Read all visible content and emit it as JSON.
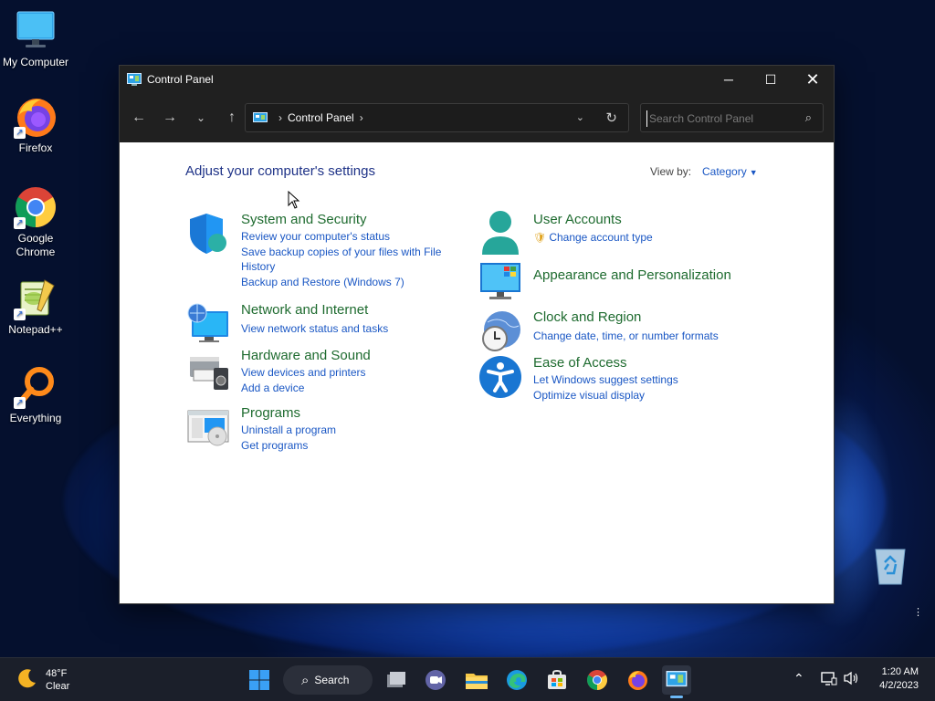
{
  "desktop": {
    "icons": [
      {
        "label": "My Computer",
        "icon": "monitor-icon"
      },
      {
        "label": "Firefox",
        "icon": "firefox-icon"
      },
      {
        "label": "Google Chrome",
        "icon": "chrome-icon"
      },
      {
        "label": "Notepad++",
        "icon": "notepadpp-icon"
      },
      {
        "label": "Everything",
        "icon": "everything-icon"
      }
    ],
    "recycle_bin_icon": "recycle-bin-icon"
  },
  "window": {
    "title": "Control Panel",
    "address": {
      "crumb": "Control Panel"
    },
    "search_placeholder": "Search Control Panel"
  },
  "content": {
    "heading": "Adjust your computer's settings",
    "view_by_label": "View by:",
    "view_by_value": "Category",
    "categories_left": [
      {
        "title": "System and Security",
        "links": [
          "Review your computer's status",
          "Save backup copies of your files with File History",
          "Backup and Restore (Windows 7)"
        ]
      },
      {
        "title": "Network and Internet",
        "links": [
          "View network status and tasks"
        ]
      },
      {
        "title": "Hardware and Sound",
        "links": [
          "View devices and printers",
          "Add a device"
        ]
      },
      {
        "title": "Programs",
        "links": [
          "Uninstall a program",
          "Get programs"
        ]
      }
    ],
    "categories_right": [
      {
        "title": "User Accounts",
        "links": [
          "Change account type"
        ]
      },
      {
        "title": "Appearance and Personalization",
        "links": []
      },
      {
        "title": "Clock and Region",
        "links": [
          "Change date, time, or number formats"
        ]
      },
      {
        "title": "Ease of Access",
        "links": [
          "Let Windows suggest settings",
          "Optimize visual display"
        ]
      }
    ]
  },
  "taskbar": {
    "weather_temp": "48°F",
    "weather_cond": "Clear",
    "search_label": "Search",
    "time": "1:20 AM",
    "date": "4/2/2023"
  },
  "colors": {
    "link": "#1a57c4",
    "category_title": "#1e6b2f",
    "heading": "#1e3287"
  }
}
